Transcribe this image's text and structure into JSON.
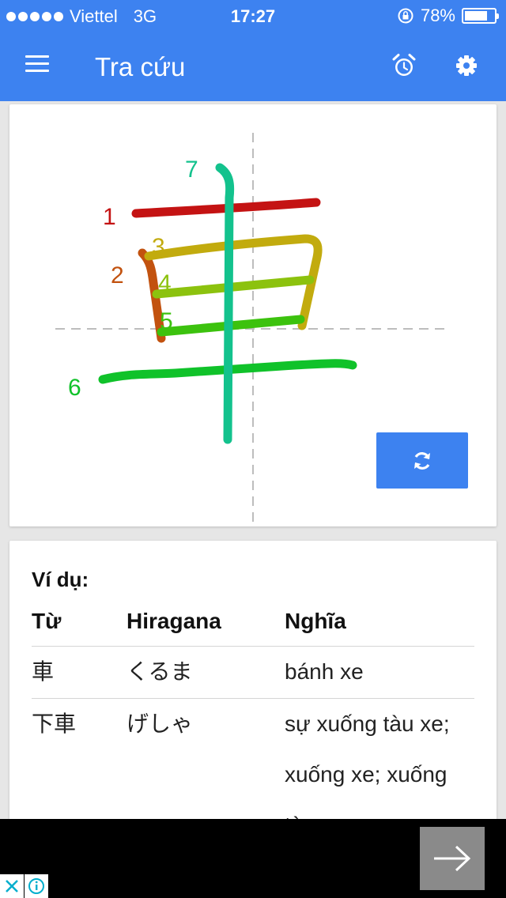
{
  "status_bar": {
    "carrier": "Viettel",
    "network": "3G",
    "time": "17:27",
    "battery_percent": "78%",
    "battery_level": 0.78
  },
  "app_bar": {
    "title": "Tra cứu",
    "icons": [
      "menu-icon",
      "alarm-clock-icon",
      "gear-icon"
    ]
  },
  "kanji": {
    "character": "車",
    "stroke_numbers": [
      "1",
      "2",
      "3",
      "4",
      "5",
      "6",
      "7"
    ],
    "stroke_colors": [
      "#c41313",
      "#c2520f",
      "#c2ab0e",
      "#8cc20e",
      "#3cc20e",
      "#10c22a",
      "#13c28d"
    ],
    "refresh_icon": "refresh-icon"
  },
  "examples": {
    "title": "Ví dụ:",
    "headers": [
      "Từ",
      "Hiragana",
      "Nghĩa"
    ],
    "rows": [
      {
        "word": "車",
        "hiragana": "くるま",
        "meaning": "bánh xe"
      },
      {
        "word": "下車",
        "hiragana": "げしゃ",
        "meaning": "sự xuống tàu xe; xuống xe; xuống tàu"
      }
    ]
  },
  "ad": {
    "next_icon": "arrow-right-icon",
    "badges": [
      "close-icon",
      "info-icon"
    ]
  },
  "colors": {
    "primary": "#3d82f0"
  }
}
